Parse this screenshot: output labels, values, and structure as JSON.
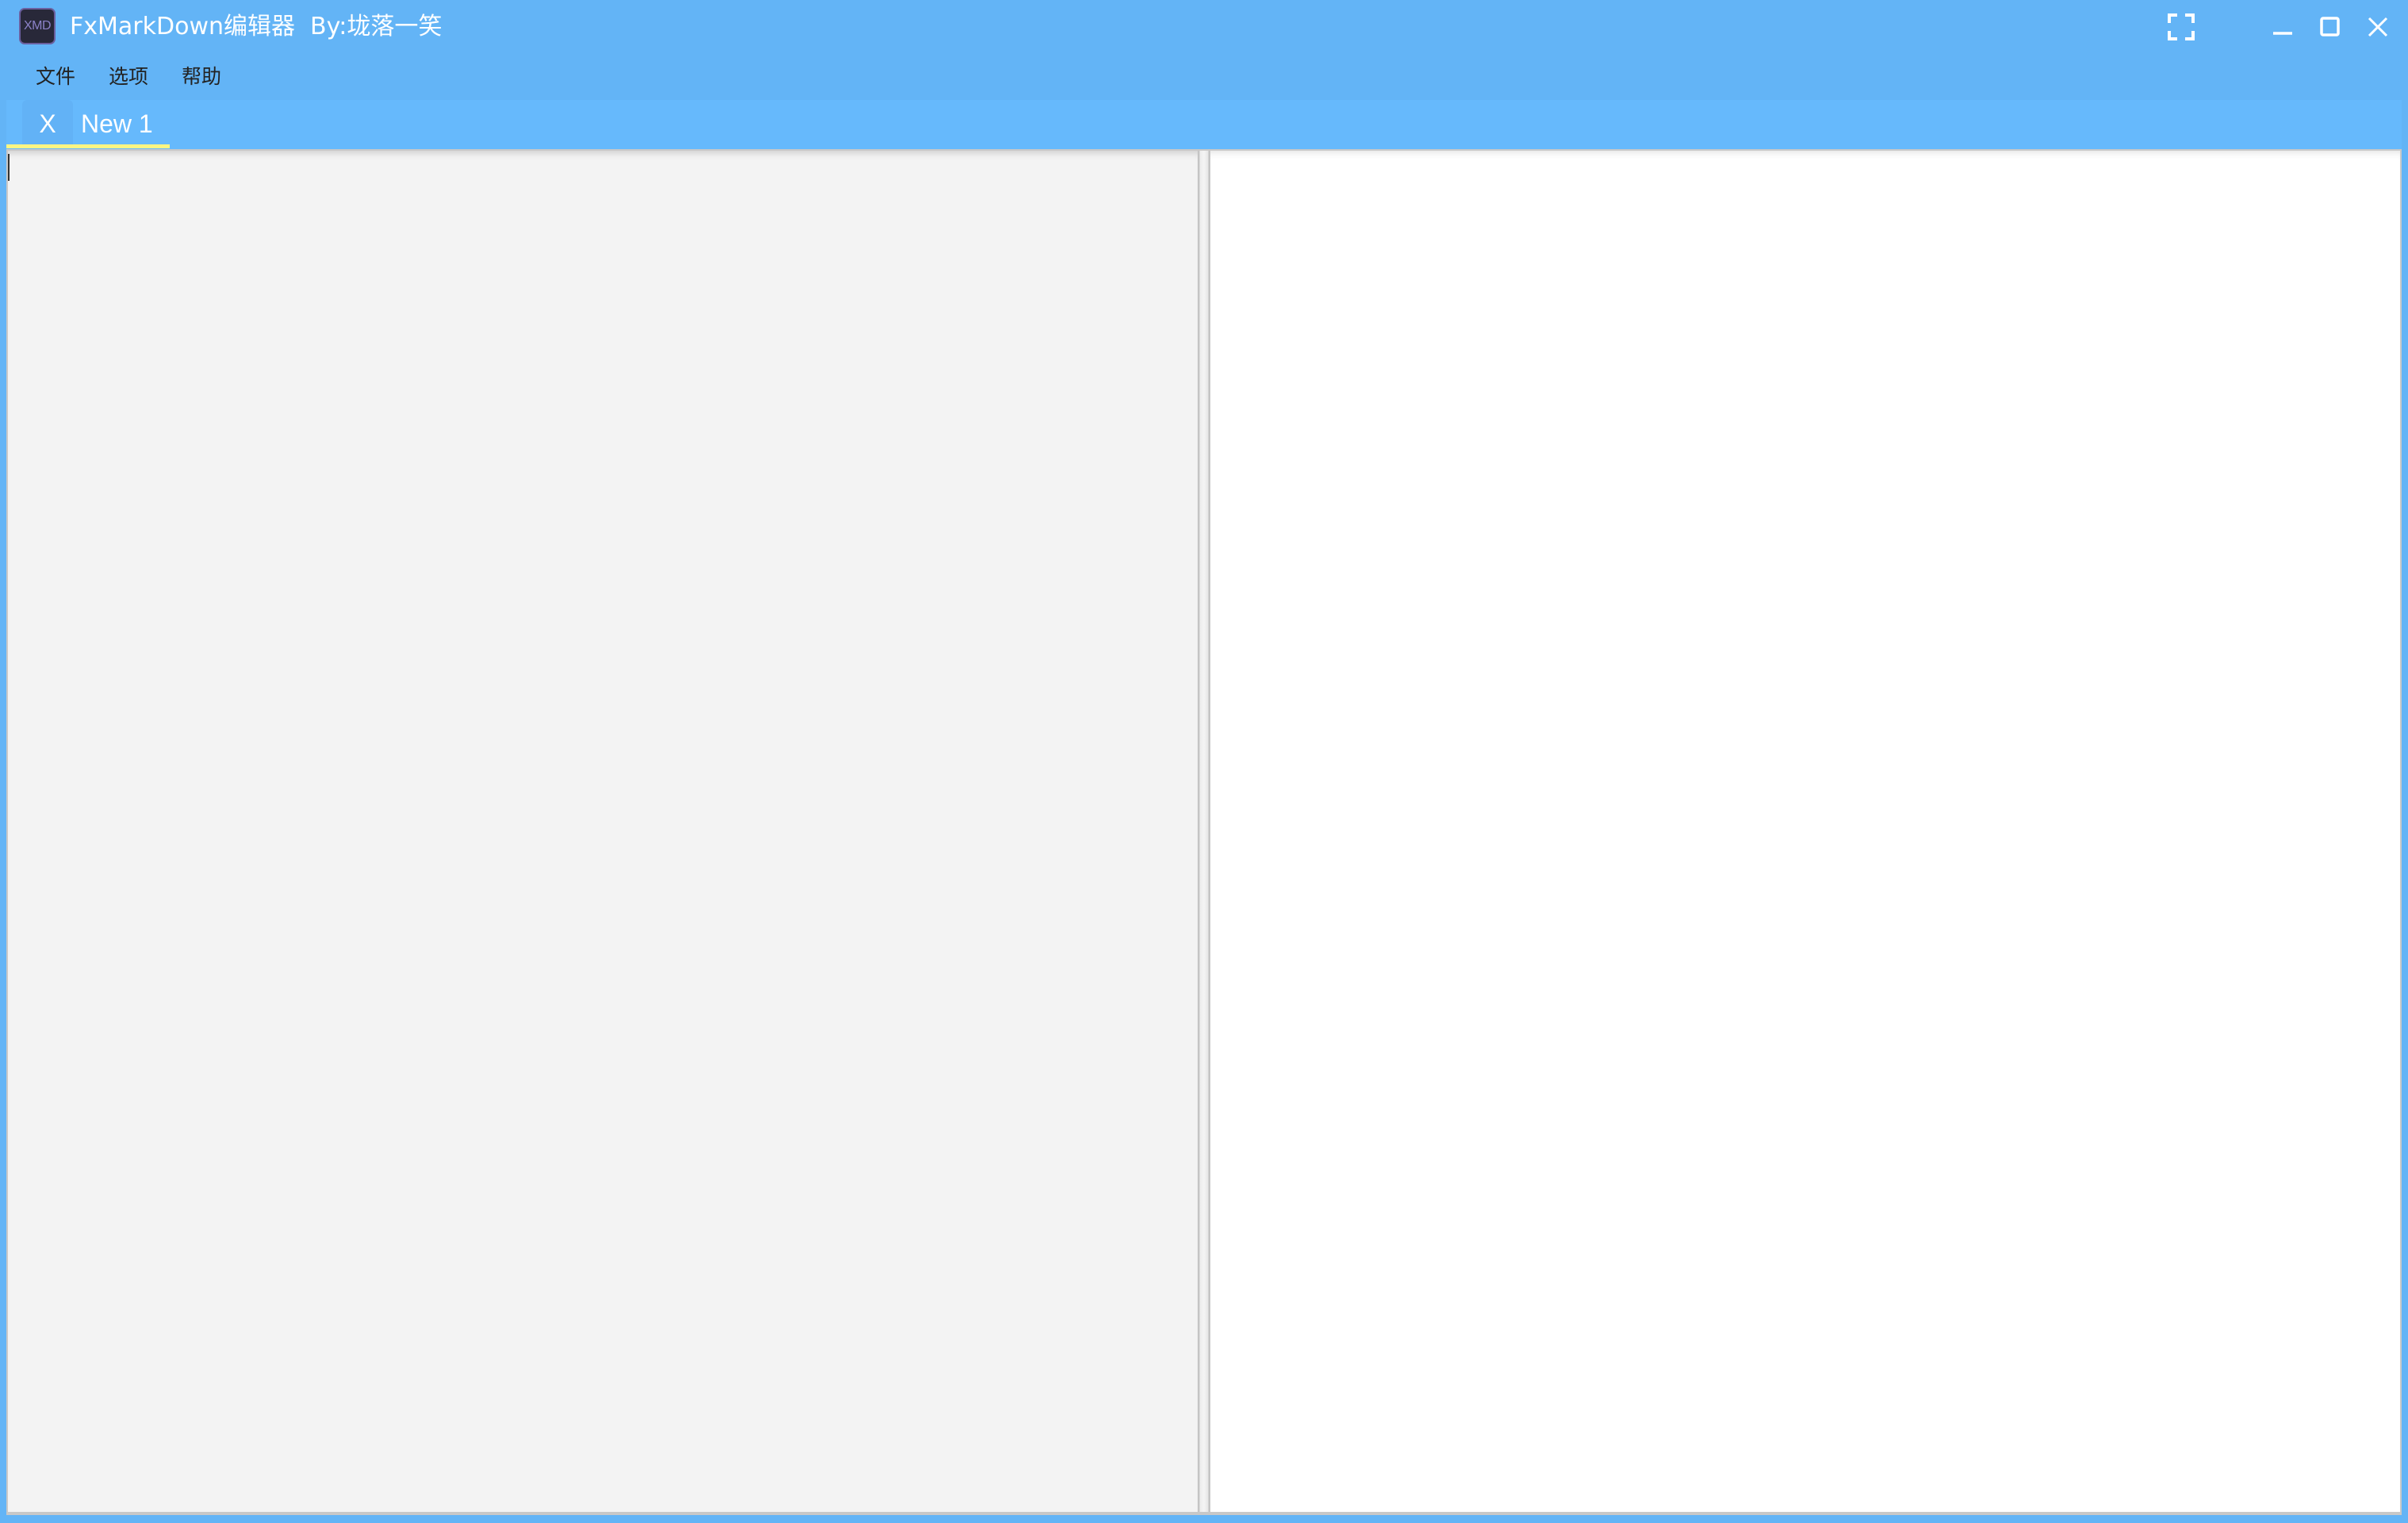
{
  "window": {
    "app_icon_text": "XMD",
    "title": "FxMarkDown编辑器  By:垅落一笑",
    "controls": [
      "fullscreen-icon",
      "minimize-icon",
      "maximize-icon",
      "close-icon"
    ]
  },
  "menu": {
    "items": [
      {
        "label": "文件"
      },
      {
        "label": "选项"
      },
      {
        "label": "帮助"
      }
    ]
  },
  "tabs": [
    {
      "close_label": "X",
      "label": "New 1",
      "active": true
    }
  ],
  "editor": {
    "content": "",
    "background": "#f3f3f3"
  },
  "preview": {
    "content": "",
    "background": "#ffffff"
  },
  "colors": {
    "window_bg": "#63b4f6",
    "tab_bar_bg": "#66b9fc",
    "active_tab_indicator": "#fbf583",
    "app_icon_bg": "#282839",
    "app_icon_text": "#8c82c8"
  }
}
